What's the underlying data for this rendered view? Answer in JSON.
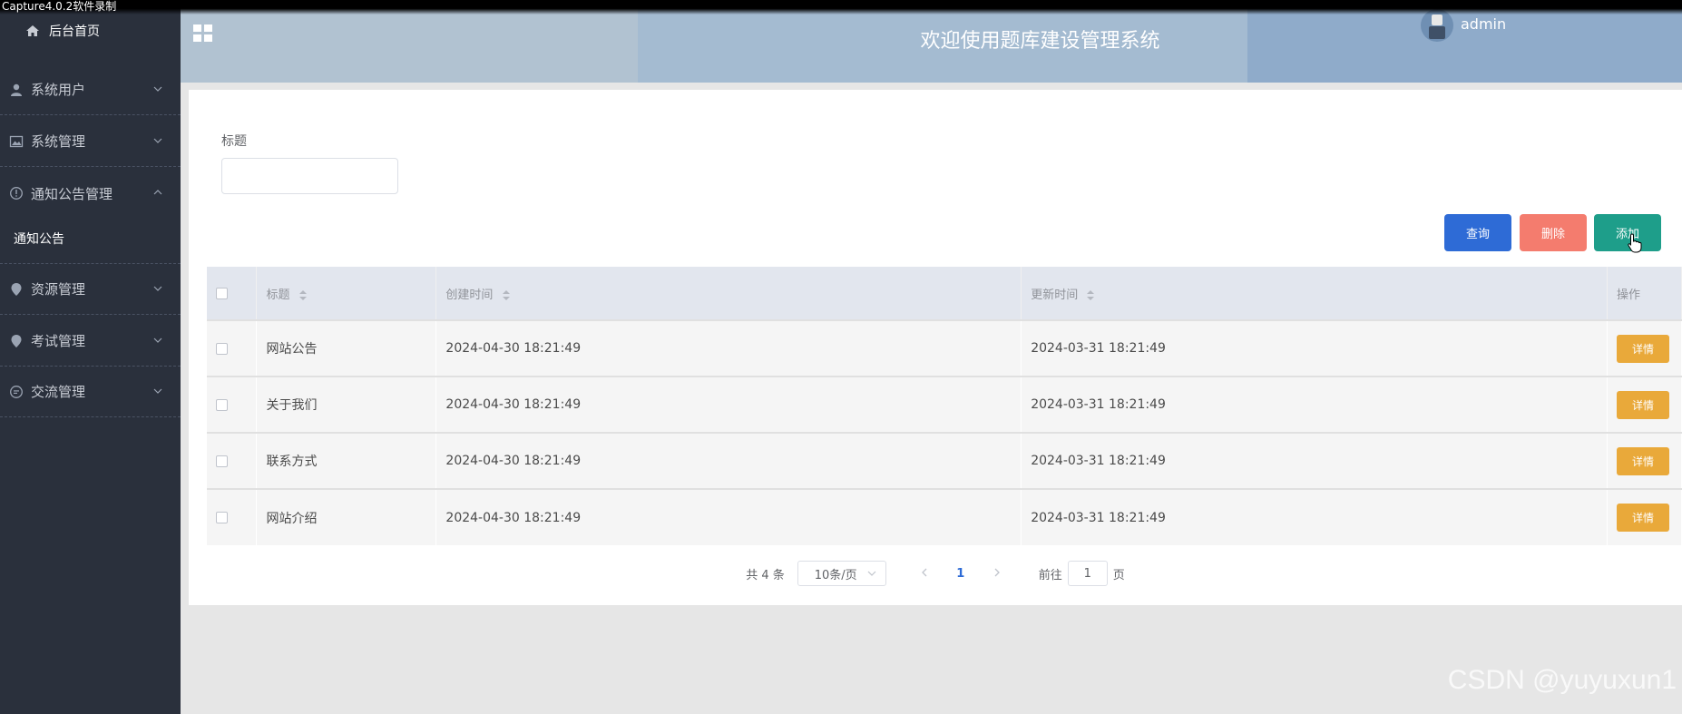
{
  "recording_label": "Capture4.0.2软件录制",
  "sidebar": {
    "home": "后台首页",
    "items": [
      {
        "label": "系统用户"
      },
      {
        "label": "系统管理"
      },
      {
        "label": "通知公告管理"
      },
      {
        "label": "资源管理"
      },
      {
        "label": "考试管理"
      },
      {
        "label": "交流管理"
      }
    ],
    "active_sub": "通知公告"
  },
  "header": {
    "title": "欢迎使用题库建设管理系统",
    "username": "admin"
  },
  "search": {
    "label": "标题",
    "value": ""
  },
  "toolbar": {
    "query": "查询",
    "delete": "删除",
    "add": "添加"
  },
  "table": {
    "headers": {
      "title": "标题",
      "created": "创建时间",
      "updated": "更新时间",
      "op": "操作"
    },
    "rows": [
      {
        "title": "网站公告",
        "created": "2024-04-30 18:21:49",
        "updated": "2024-03-31 18:21:49",
        "action": "详情"
      },
      {
        "title": "关于我们",
        "created": "2024-04-30 18:21:49",
        "updated": "2024-03-31 18:21:49",
        "action": "详情"
      },
      {
        "title": "联系方式",
        "created": "2024-04-30 18:21:49",
        "updated": "2024-03-31 18:21:49",
        "action": "详情"
      },
      {
        "title": "网站介绍",
        "created": "2024-04-30 18:21:49",
        "updated": "2024-03-31 18:21:49",
        "action": "详情"
      }
    ]
  },
  "pagination": {
    "total": "共 4 条",
    "page_size": "10条/页",
    "current_page": "1",
    "goto_label": "前往",
    "goto_value": "1",
    "page_suffix": "页"
  },
  "watermark": "CSDN @yuyuxun1",
  "colors": {
    "sidebar": "#2a303c",
    "query": "#2e6bd6",
    "delete": "#f47c6e",
    "add": "#1e9e8a",
    "detail": "#e9a93a"
  }
}
